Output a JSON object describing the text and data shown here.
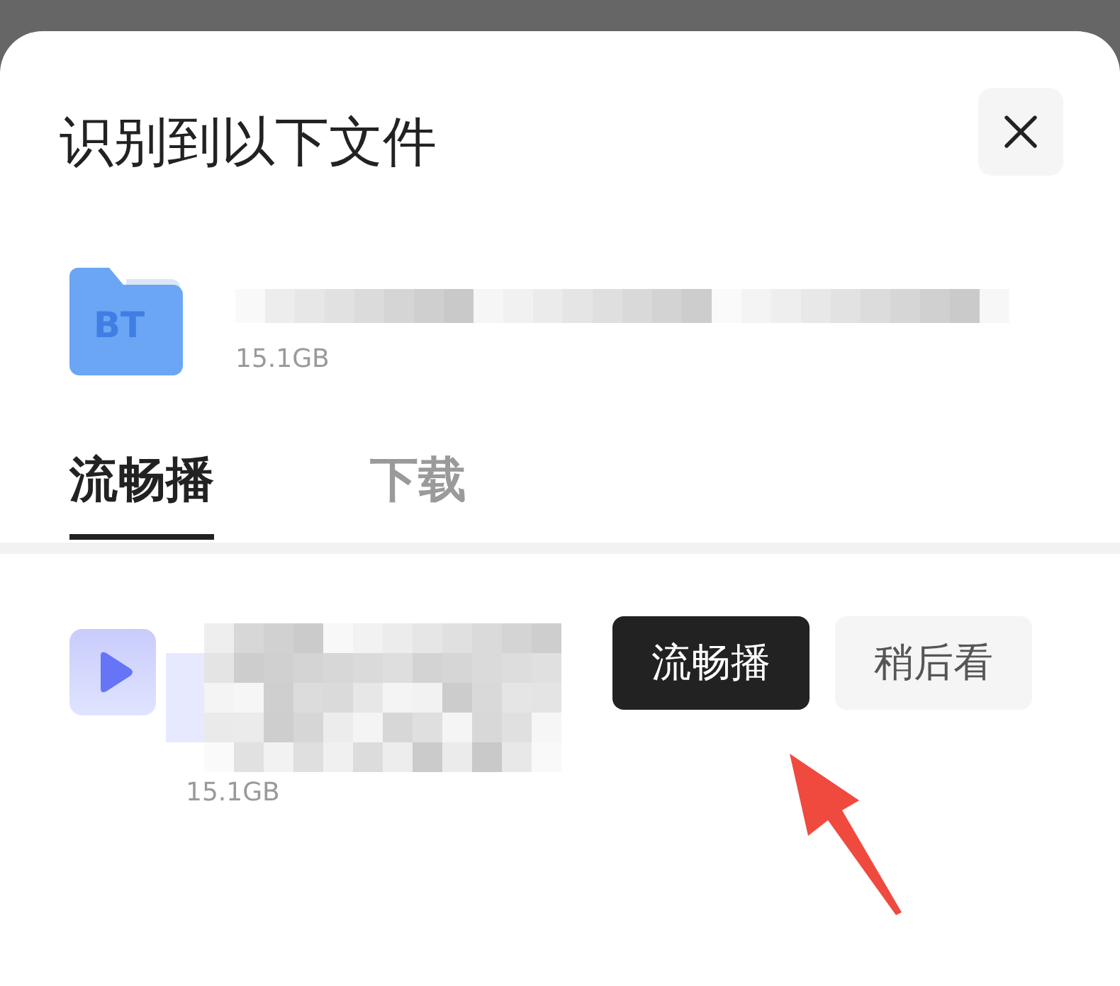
{
  "dialog": {
    "title": "识别到以下文件"
  },
  "torrent": {
    "type_label": "BT",
    "size": "15.1GB"
  },
  "tabs": [
    {
      "label": "流畅播",
      "selected": true
    },
    {
      "label": "下载",
      "selected": false
    }
  ],
  "videos": [
    {
      "size": "15.1GB",
      "actions": [
        {
          "label": "流畅播",
          "kind": "primary"
        },
        {
          "label": "稍后看",
          "kind": "secondary"
        }
      ]
    }
  ]
}
